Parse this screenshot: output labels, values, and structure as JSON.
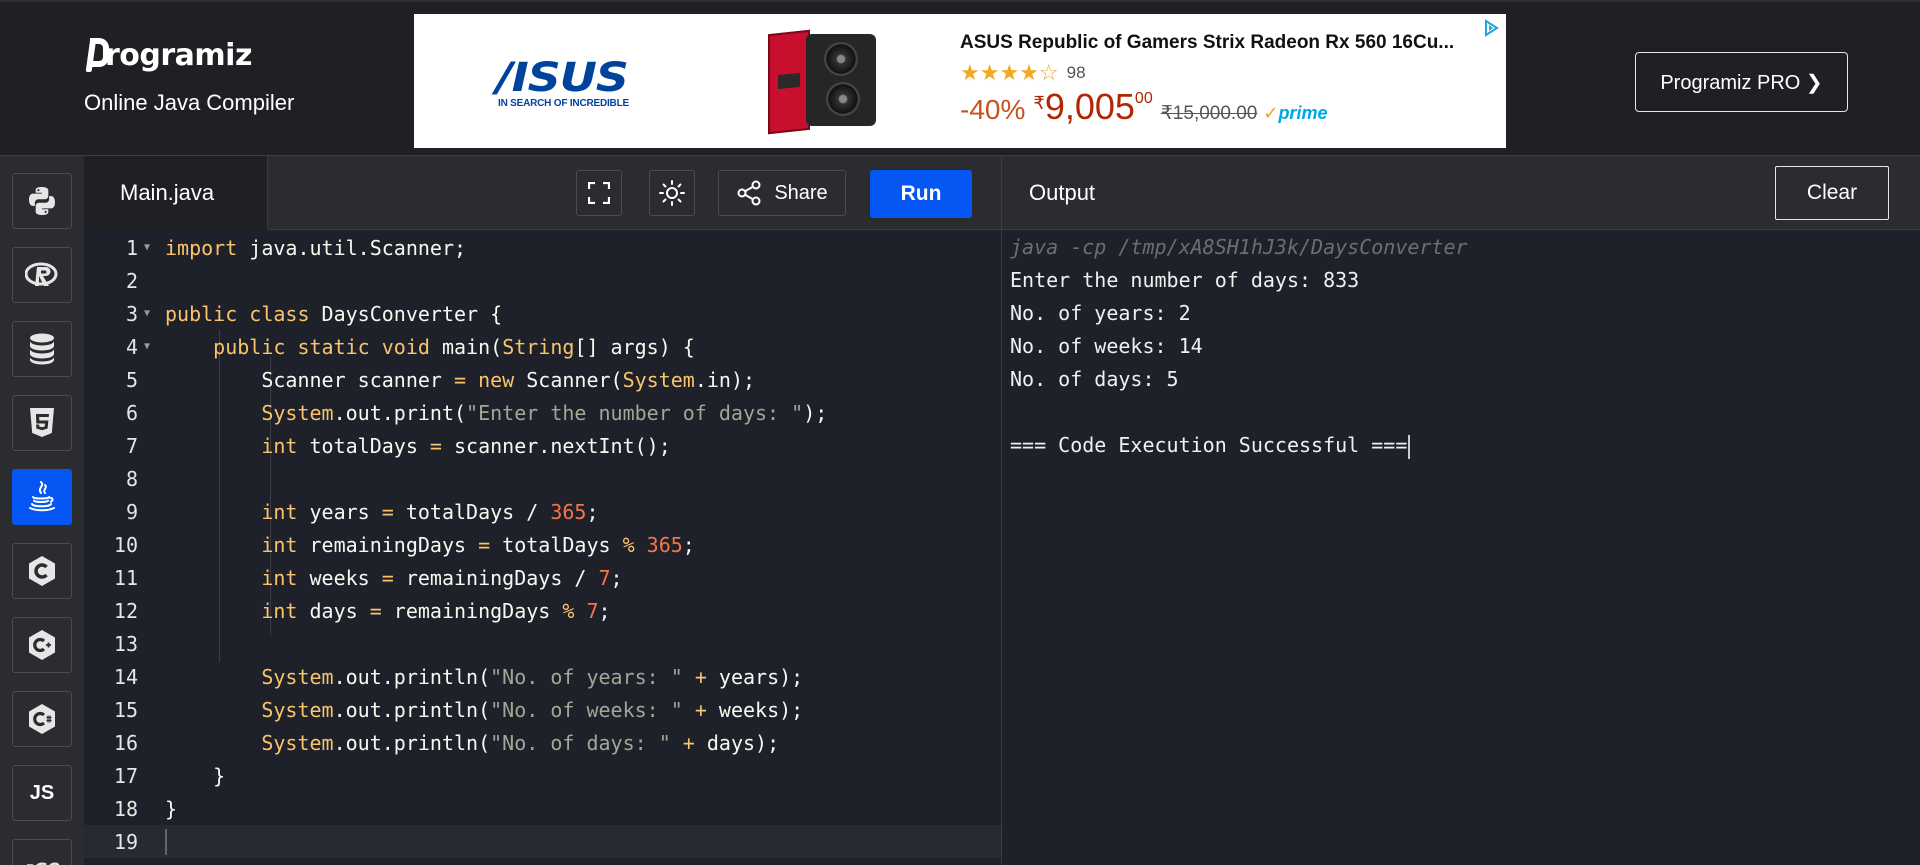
{
  "header": {
    "brand": "rogramiz",
    "subtitle": "Online Java Compiler",
    "pro_button": "Programiz PRO ❯"
  },
  "ad": {
    "brand": "/ISUS",
    "brand_tagline": "IN SEARCH OF INCREDIBLE",
    "title": "ASUS Republic of Gamers Strix Radeon Rx 560 16Cu...",
    "stars": "★★★★☆",
    "rating_count": "98",
    "discount": "-40%",
    "currency": "₹",
    "price": "9,005",
    "price_fraction": "00",
    "old_price": "₹15,000.00",
    "prime_check": "✓",
    "prime": "prime"
  },
  "sidebar": {
    "languages": [
      {
        "name": "python",
        "icon": "python-icon"
      },
      {
        "name": "r",
        "icon": "r-icon"
      },
      {
        "name": "sql",
        "icon": "database-icon"
      },
      {
        "name": "html",
        "icon": "html5-icon"
      },
      {
        "name": "java",
        "icon": "java-icon",
        "active": true
      },
      {
        "name": "c",
        "icon": "c-icon"
      },
      {
        "name": "cpp",
        "icon": "cpp-icon"
      },
      {
        "name": "csharp",
        "icon": "csharp-icon"
      },
      {
        "name": "javascript",
        "icon": "js-icon",
        "label": "JS"
      },
      {
        "name": "go",
        "icon": "go-icon"
      }
    ]
  },
  "editor": {
    "file_tab": "Main.java",
    "share_label": "Share",
    "run_label": "Run",
    "lines": [
      {
        "n": "1",
        "text": "import java.util.Scanner;"
      },
      {
        "n": "2",
        "text": ""
      },
      {
        "n": "3",
        "text": "public class DaysConverter {"
      },
      {
        "n": "4",
        "text": "    public static void main(String[] args) {"
      },
      {
        "n": "5",
        "text": "        Scanner scanner = new Scanner(System.in);"
      },
      {
        "n": "6",
        "text": "        System.out.print(\"Enter the number of days: \");"
      },
      {
        "n": "7",
        "text": "        int totalDays = scanner.nextInt();"
      },
      {
        "n": "8",
        "text": ""
      },
      {
        "n": "9",
        "text": "        int years = totalDays / 365;"
      },
      {
        "n": "10",
        "text": "        int remainingDays = totalDays % 365;"
      },
      {
        "n": "11",
        "text": "        int weeks = remainingDays / 7;"
      },
      {
        "n": "12",
        "text": "        int days = remainingDays % 7;"
      },
      {
        "n": "13",
        "text": ""
      },
      {
        "n": "14",
        "text": "        System.out.println(\"No. of years: \" + years);"
      },
      {
        "n": "15",
        "text": "        System.out.println(\"No. of weeks: \" + weeks);"
      },
      {
        "n": "16",
        "text": "        System.out.println(\"No. of days: \" + days);"
      },
      {
        "n": "17",
        "text": "    }"
      },
      {
        "n": "18",
        "text": "}"
      },
      {
        "n": "19",
        "text": ""
      }
    ]
  },
  "output": {
    "title": "Output",
    "clear_label": "Clear",
    "lines": [
      "java -cp /tmp/xA8SH1hJ3k/DaysConverter",
      "Enter the number of days: 833",
      "No. of years: 2",
      "No. of weeks: 14",
      "No. of days: 5",
      "",
      "=== Code Execution Successful ==="
    ]
  }
}
